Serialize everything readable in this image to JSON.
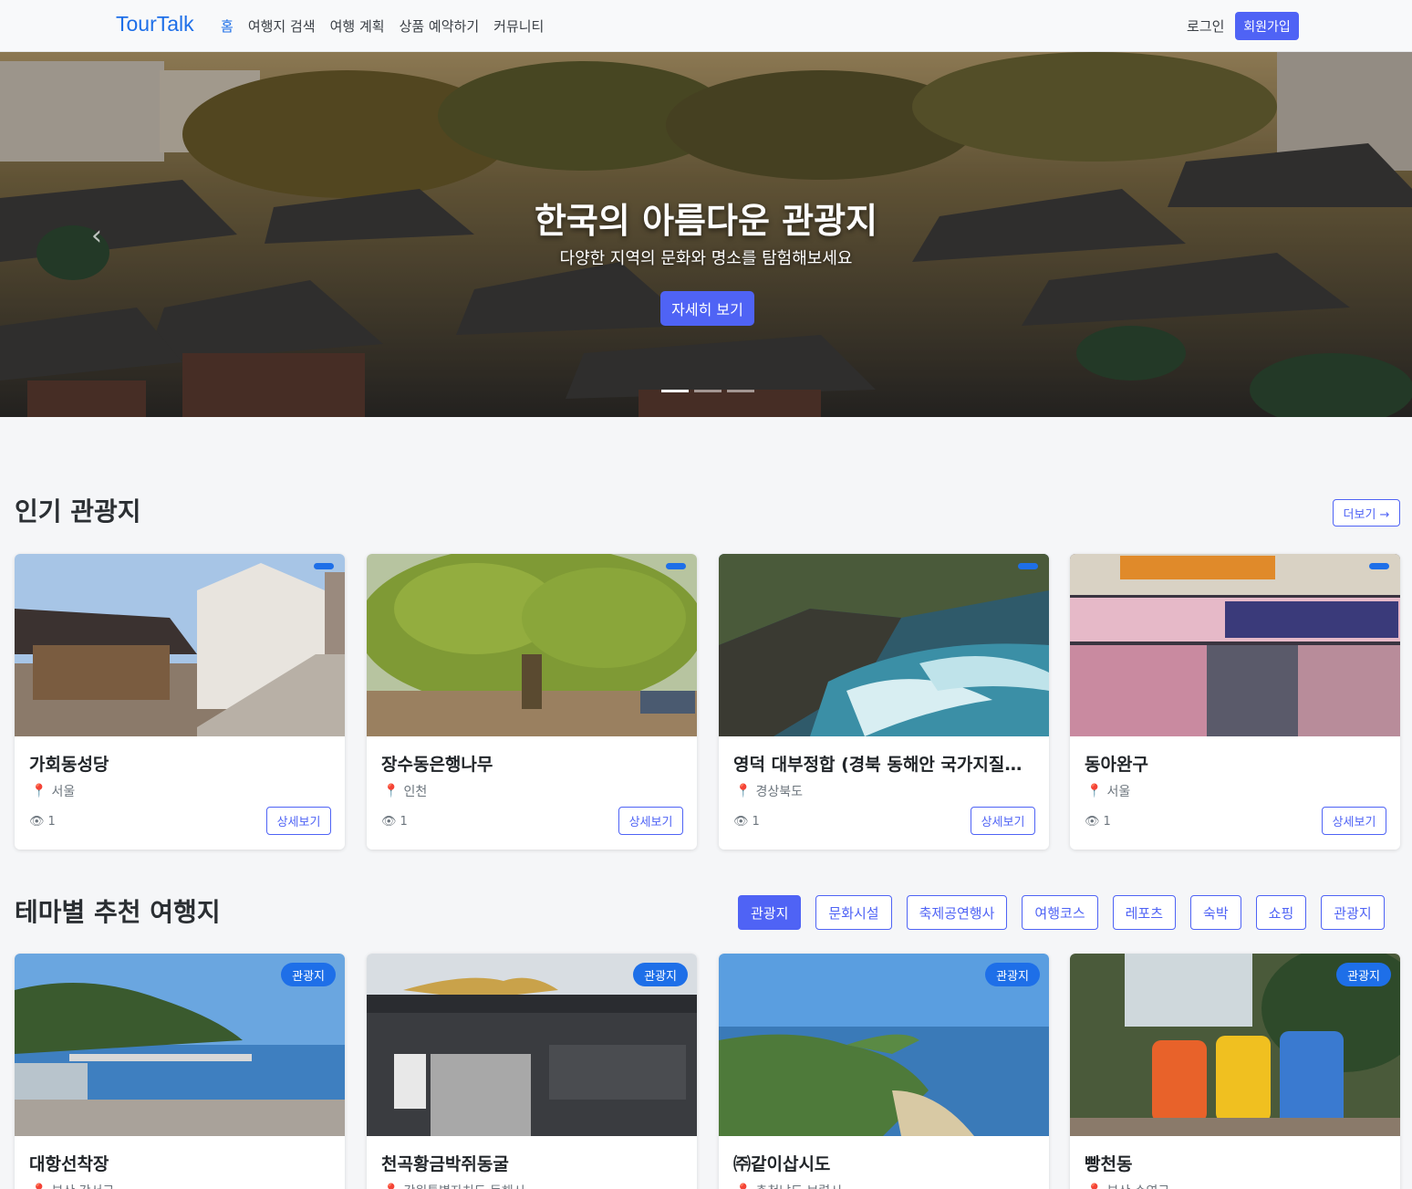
{
  "nav": {
    "brand": "TourTalk",
    "links": [
      "홈",
      "여행지 검색",
      "여행 계획",
      "상품 예약하기",
      "커뮤니티"
    ],
    "login": "로그인",
    "signup": "회원가입"
  },
  "hero": {
    "title": "한국의 아름다운 관광지",
    "subtitle": "다양한 지역의 문화와 명소를 탐험해보세요",
    "button": "자세히 보기",
    "slide_count": 3,
    "active_slide": 1
  },
  "popular": {
    "title": "인기 관광지",
    "more": "더보기 →",
    "cards": [
      {
        "name": "가회동성당",
        "location": "서울",
        "views": "1",
        "button": "상세보기"
      },
      {
        "name": "장수동은행나무",
        "location": "인천",
        "views": "1",
        "button": "상세보기"
      },
      {
        "name": "영덕 대부정합 (경북 동해안 국가지질공원)",
        "location": "경상북도",
        "views": "1",
        "button": "상세보기"
      },
      {
        "name": "동아완구",
        "location": "서울",
        "views": "1",
        "button": "상세보기"
      }
    ]
  },
  "theme": {
    "title": "테마별 추천 여행지",
    "filters": [
      "관광지",
      "문화시설",
      "축제공연행사",
      "여행코스",
      "레포츠",
      "숙박",
      "쇼핑",
      "관광지"
    ],
    "active_filter": 0,
    "cards": [
      {
        "name": "대항선착장",
        "location": "부산 강서구",
        "badge": "관광지"
      },
      {
        "name": "천곡황금박쥐동굴",
        "location": "강원특별자치도 동해시",
        "badge": "관광지"
      },
      {
        "name": "㈜같이삽시도",
        "location": "충청남도 보령시",
        "badge": "관광지"
      },
      {
        "name": "빵천동",
        "location": "부산 수영구",
        "badge": "관광지"
      }
    ]
  },
  "colors": {
    "primary": "#4f63f5",
    "brand": "#1e6fe8"
  }
}
